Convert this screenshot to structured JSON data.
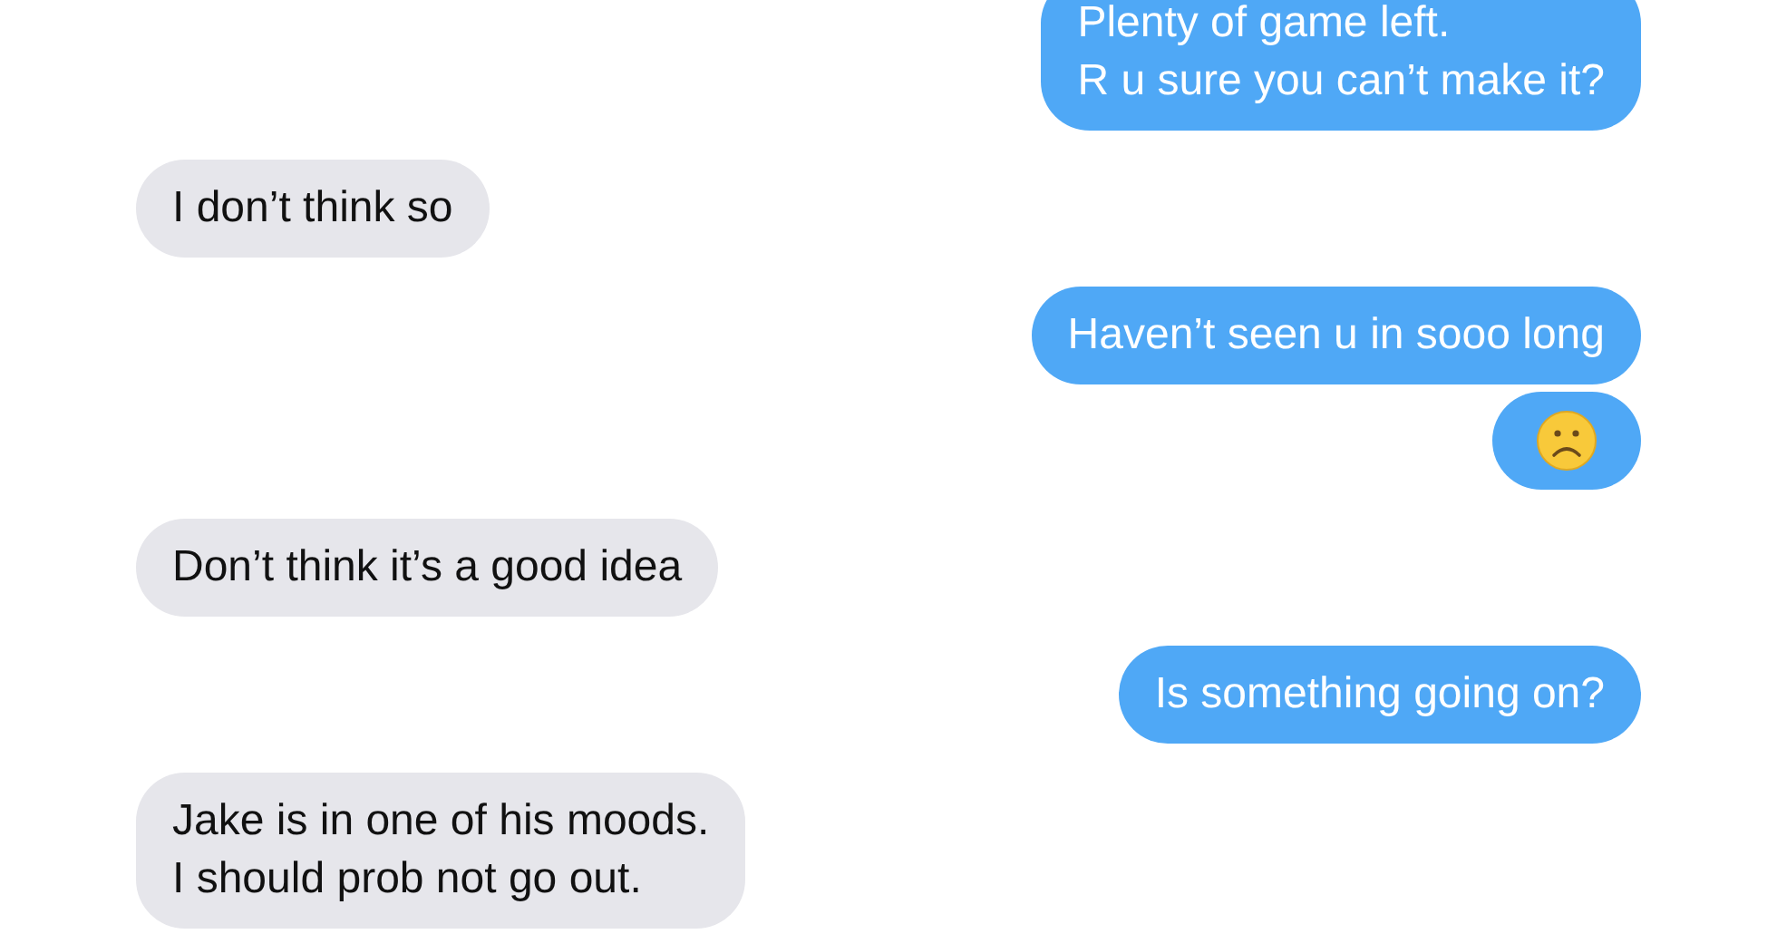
{
  "messages": [
    {
      "outgoing": true,
      "kind": "text",
      "text": "Plenty of game left.\nR u sure you can’t make it?"
    },
    {
      "outgoing": false,
      "kind": "text",
      "text": "I don’t think so"
    },
    {
      "outgoing": true,
      "kind": "text",
      "text": "Haven’t seen u in sooo long"
    },
    {
      "outgoing": true,
      "kind": "emoji"
    },
    {
      "outgoing": false,
      "kind": "text",
      "text": "Don’t think it’s a good idea"
    },
    {
      "outgoing": true,
      "kind": "text",
      "text": "Is something going on?"
    },
    {
      "outgoing": false,
      "kind": "text",
      "text": "Jake is in one of his moods.\nI should prob not go out."
    }
  ]
}
